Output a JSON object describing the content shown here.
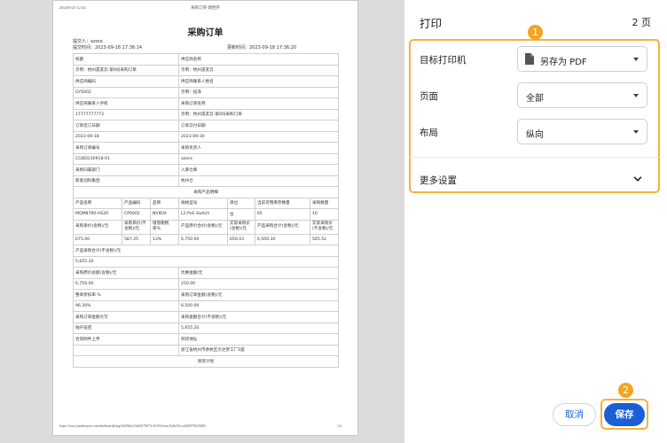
{
  "preview": {
    "header_timestamp": "2024/6/23 12:34",
    "header_title": "采购订单-建档存",
    "title": "采购订单",
    "submitter_label": "提交人：azora",
    "submit_time": "提交时间：2023-09-18 17:36:14",
    "update_time": "更新时间：2023-09-18 17:36:20",
    "rows": [
      [
        "标题",
        "供应商名称"
      ],
      [
        "示例：杭州遗友云-第6份采购订单",
        "示例：杭州遗友云"
      ],
      [
        "供应商编码",
        "供应商联系人姓名"
      ],
      [
        "GYS002",
        "示例：纪泽"
      ],
      [
        "供应商联系人手机",
        "采购订单名称"
      ],
      [
        "17777777772",
        "示例：杭州遗友云-第6份采购订单"
      ],
      [
        "订单签订日期",
        "订单交付日期"
      ],
      [
        "2023-09-18",
        "2023-09-30"
      ],
      [
        "采购订单编号",
        "采购负责人"
      ],
      [
        "CGDD230918-01",
        "azora"
      ],
      [
        "采购归属部门",
        "入库仓库"
      ],
      [
        "新奥创科集团",
        "杭州仓"
      ]
    ],
    "product_section": "采购产品明细",
    "product_headers": [
      "产品名称",
      "产品编码",
      "品牌",
      "规格型号",
      "单位",
      "当前可用库存数量",
      "采购数量"
    ],
    "product_row": [
      "MQM8790-HS2R",
      "CP0002",
      "NVIDIA",
      "L2-PoE-Switch",
      "台",
      "65",
      "10"
    ],
    "price_headers": [
      "采购单价(含税)/元",
      "采购单价(不含税)/元",
      "增值税税率%",
      "产品原价合价(含税)/元",
      "实际采购价(含税)/元",
      "产品采购合计(含税)/元",
      "实际采购价(不含税)/元"
    ],
    "price_row": [
      "675.00",
      "587.25",
      "13%",
      "6,750.00",
      "650.03",
      "6,500.30",
      "565.52"
    ],
    "subtotal_label": "产品采购合计(不含税)/元",
    "subtotal_value": "5,655.20",
    "summary_rows": [
      [
        "采购原价总额(含税)/元",
        "优惠金额/元"
      ],
      [
        "6,750.00",
        "250.00"
      ],
      [
        "整单折扣率 %",
        "采购订单金额(含税)/元"
      ],
      [
        "96.30%",
        "6,500.00"
      ],
      [
        "采购订单金额大写",
        "采购金额合计(不含税)/元"
      ],
      [
        "陆仟伍佰",
        "5,655.20"
      ],
      [
        "合同附件上传",
        "到货地址"
      ],
      [
        "",
        "浙江省杭州市余杭区贝达梦工厂E座"
      ]
    ],
    "delivery_plan": "到货计划",
    "footer_url": "https://www.jiandaoyun.com/dashboard#/app/6629b4c53a81b79673c19194/form/5e8a74cccd36f970025600",
    "footer_page": "1/2"
  },
  "panel": {
    "title": "打印",
    "page_count": "2 页",
    "badge_1": "1",
    "badge_2": "2",
    "printer_label": "目标打印机",
    "printer_value": "另存为 PDF",
    "pages_label": "页面",
    "pages_value": "全部",
    "layout_label": "布局",
    "layout_value": "纵向",
    "more_label": "更多设置",
    "cancel_label": "取消",
    "save_label": "保存",
    "accent_color": "#1a5fd6",
    "highlight_color": "#f6b23a"
  }
}
